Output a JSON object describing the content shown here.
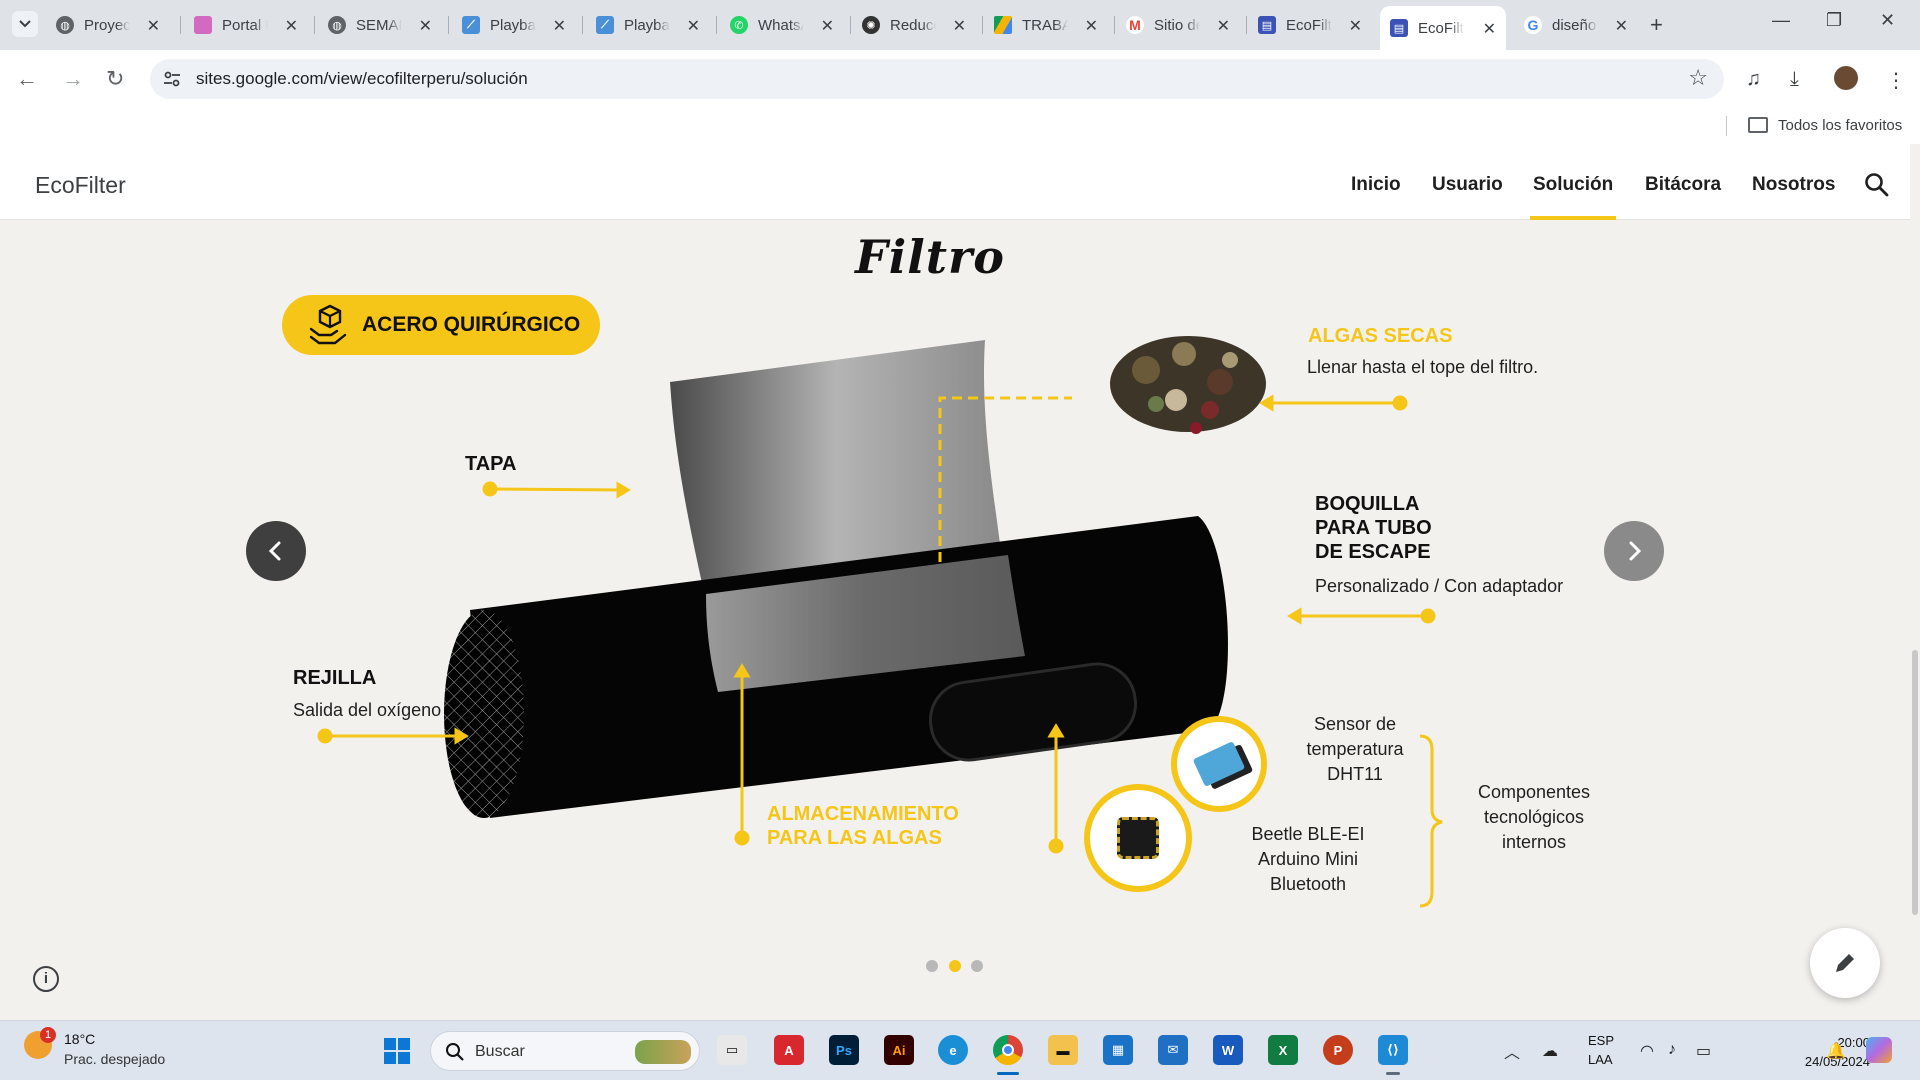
{
  "browser": {
    "tabs": [
      {
        "title": "Proyecto",
        "icon": "globe-icon",
        "color": "#5f6368"
      },
      {
        "title": "Portal UTP",
        "icon": "portal-icon",
        "color": "#d36ac2"
      },
      {
        "title": "SEMANA",
        "icon": "globe-icon",
        "color": "#5f6368"
      },
      {
        "title": "Playback",
        "icon": "playback-icon",
        "color": "#4a90d9"
      },
      {
        "title": "Playback",
        "icon": "playback-icon",
        "color": "#4a90d9"
      },
      {
        "title": "WhatsApp",
        "icon": "whatsapp-icon",
        "color": "#25d366"
      },
      {
        "title": "Reducción",
        "icon": "openai-icon",
        "color": "#333333"
      },
      {
        "title": "TRABAJO",
        "icon": "drive-icon",
        "color": "#f4b400"
      },
      {
        "title": "Sitio de",
        "icon": "gmail-icon",
        "color": "#ea4335"
      },
      {
        "title": "EcoFilter",
        "icon": "sites-icon",
        "color": "#3b53b5"
      },
      {
        "title": "EcoFilter",
        "icon": "sites-icon",
        "color": "#3b53b5",
        "active": true
      },
      {
        "title": "diseño",
        "icon": "google-icon",
        "color": "#4285f4"
      }
    ],
    "url": "sites.google.com/view/ecofilterperu/solución",
    "bookmarks_label": "Todos los favoritos"
  },
  "site": {
    "brand": "EcoFilter",
    "nav": [
      "Inicio",
      "Usuario",
      "Solución",
      "Bitácora",
      "Nosotros"
    ],
    "active_nav": "Solución"
  },
  "slide": {
    "heading": "Filtro",
    "pill_label": "ACERO QUIRÚRGICO",
    "algas": {
      "title": "ALGAS SECAS",
      "desc": "Llenar hasta el tope del filtro."
    },
    "tapa": {
      "title": "TAPA"
    },
    "boquilla": {
      "line1": "BOQUILLA",
      "line2": "PARA TUBO",
      "line3": "DE ESCAPE",
      "desc": "Personalizado / Con adaptador"
    },
    "rejilla": {
      "title": "REJILLA",
      "desc": "Salida del oxígeno"
    },
    "almacenamiento": {
      "line1": "ALMACENAMIENTO",
      "line2": "PARA LAS ALGAS"
    },
    "sensor": {
      "line1": "Sensor de",
      "line2": "temperatura",
      "line3": "DHT11"
    },
    "beetle": {
      "line1": "Beetle BLE-EI",
      "line2": "Arduino Mini",
      "line3": "Bluetooth"
    },
    "componentes": {
      "line1": "Componentes",
      "line2": "tecnológicos",
      "line3": "internos"
    },
    "slide_count": 3,
    "current_slide": 2
  },
  "taskbar": {
    "temperature": "18°C",
    "condition": "Prac. despejado",
    "weather_badge": "1",
    "search_placeholder": "Buscar",
    "apps": [
      "file-explorer-app-icon",
      "autocad-app-icon",
      "photoshop-app-icon",
      "illustrator-app-icon",
      "edge-app-icon",
      "chrome-app-icon",
      "folder-app-icon",
      "store-app-icon",
      "mail-app-icon",
      "word-app-icon",
      "excel-app-icon",
      "powerpoint-app-icon",
      "vscode-app-icon"
    ],
    "lang_line1": "ESP",
    "lang_line2": "LAA",
    "time": "20:00",
    "date": "24/05/2024"
  },
  "colors": {
    "accent": "#f5c518",
    "dark": "#111111"
  }
}
